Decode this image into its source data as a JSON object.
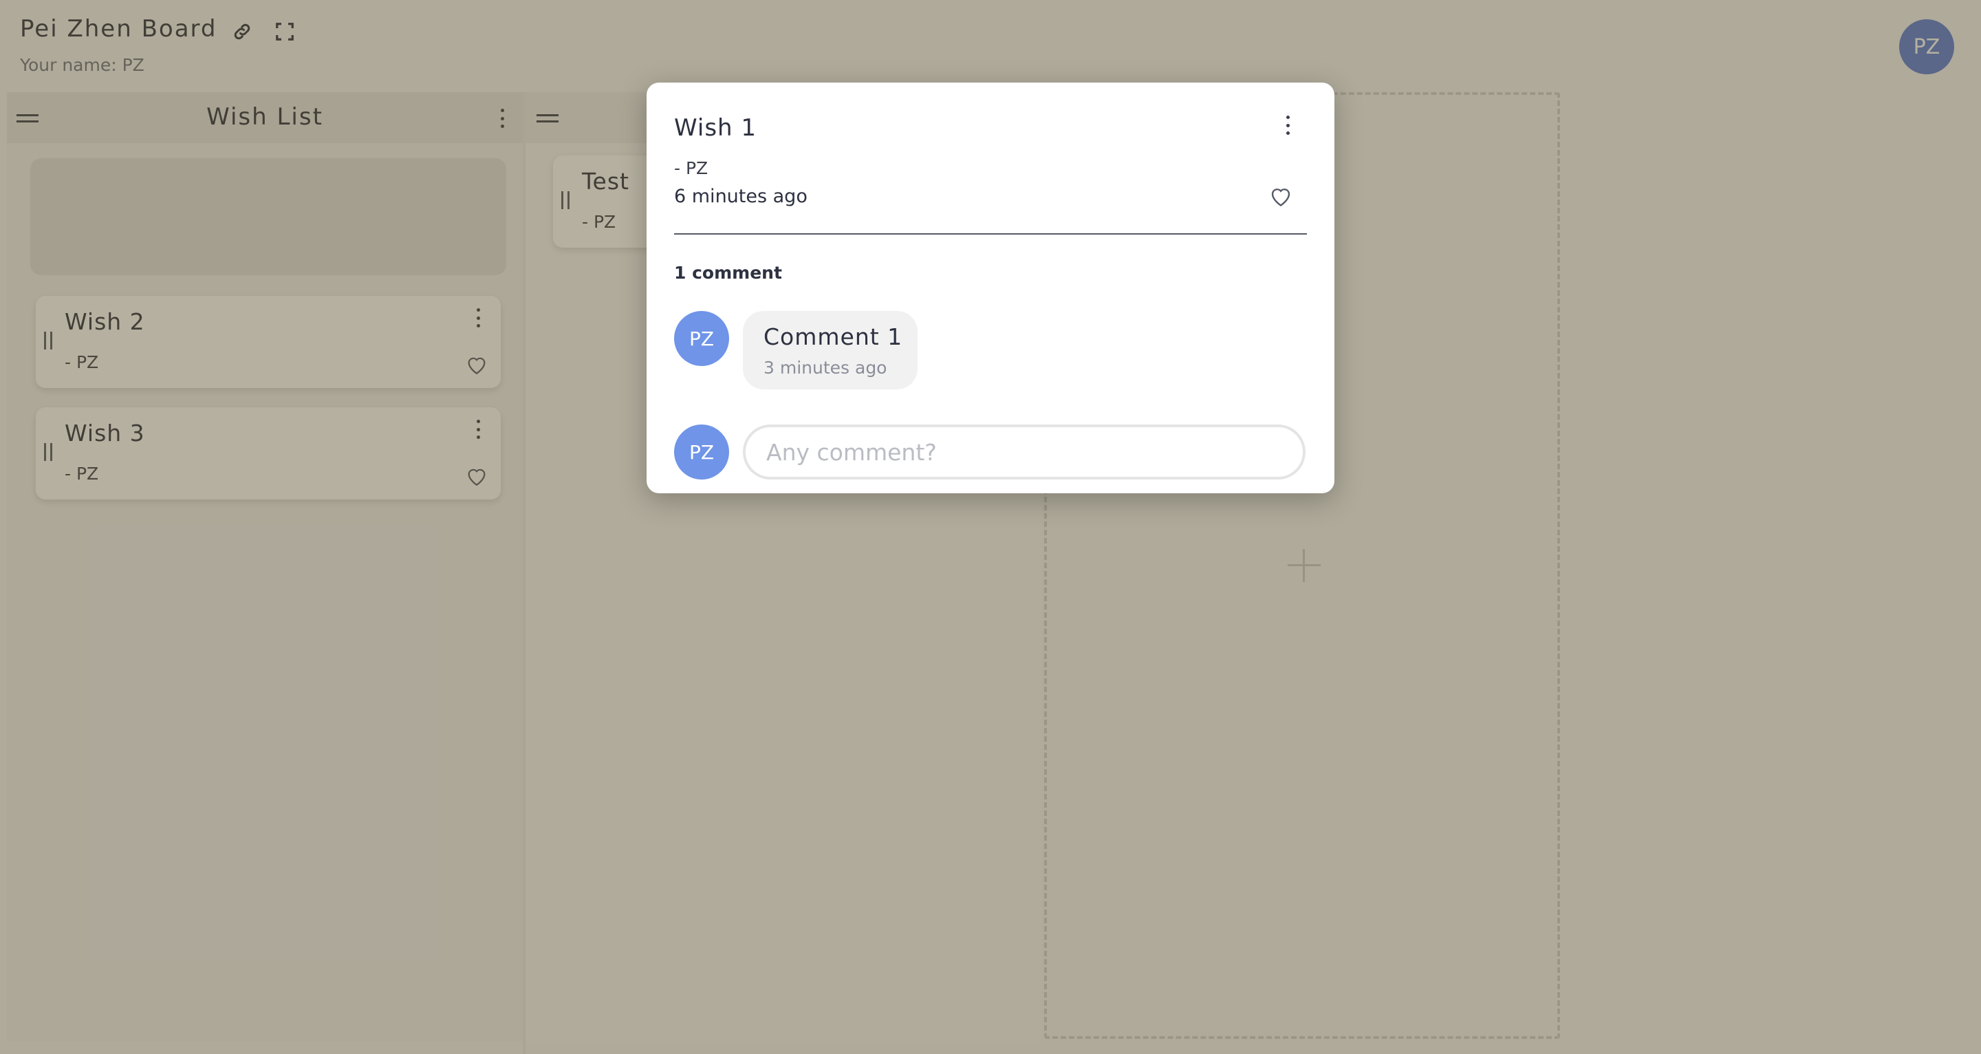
{
  "board": {
    "title": "Pei Zhen Board",
    "your_name": "Your name: PZ",
    "user_initials": "PZ"
  },
  "columns": [
    {
      "title": "Wish List",
      "cards": [
        {
          "title": "Wish 2",
          "author": "- PZ"
        },
        {
          "title": "Wish 3",
          "author": "- PZ"
        }
      ]
    },
    {
      "title": "",
      "cards": [
        {
          "title": "Test",
          "author": "- PZ"
        }
      ]
    }
  ],
  "modal": {
    "title": "Wish 1",
    "author": "- PZ",
    "time": "6 minutes ago",
    "comment_count": "1 comment",
    "comments": [
      {
        "initials": "PZ",
        "text": "Comment 1",
        "time": "3 minutes ago"
      }
    ],
    "input_initials": "PZ",
    "input_placeholder": "Any comment?"
  },
  "colors": {
    "avatar": "#6f94e8",
    "overlay": "rgba(90,80,45,0.45)"
  }
}
